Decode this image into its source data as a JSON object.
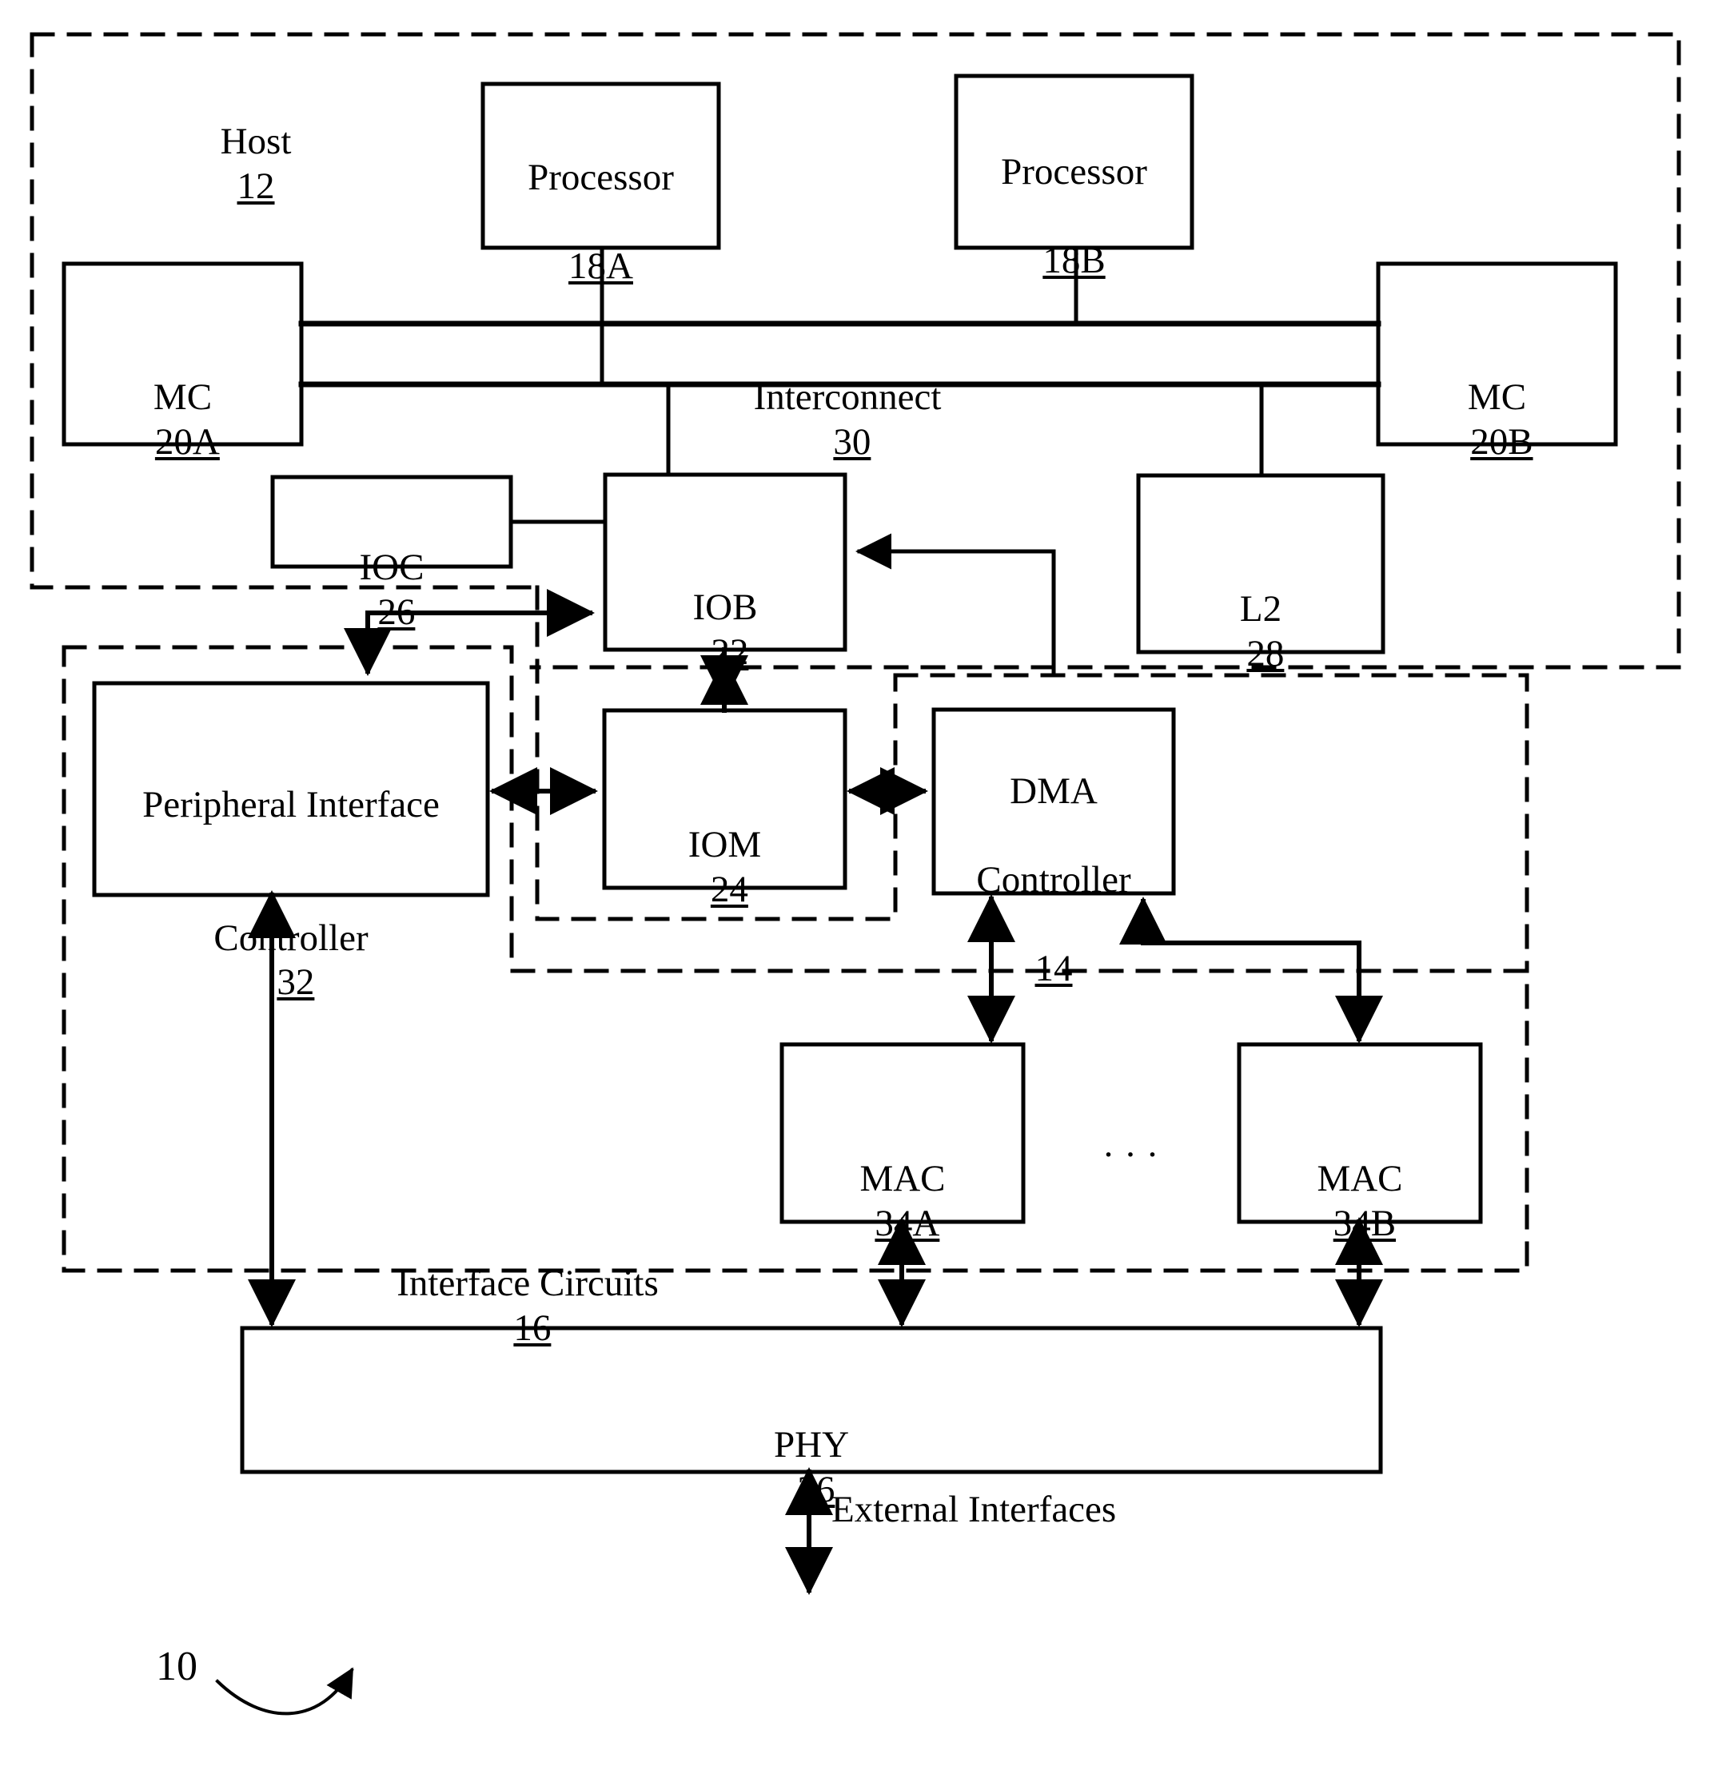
{
  "figure": {
    "reference_numeral": "10",
    "dots_between_macs": ". . ."
  },
  "dashed_regions": [
    {
      "name": "host",
      "label_text": "Host ",
      "label_num": "12"
    },
    {
      "name": "interface-circuits",
      "label_text": "Interface Circuits ",
      "label_num": "16"
    },
    {
      "name": "iom-region",
      "label_text": "",
      "label_num": ""
    },
    {
      "name": "dma-region",
      "label_text": "",
      "label_num": ""
    }
  ],
  "boxes": [
    {
      "id": "processor-18a",
      "line1": "Processor",
      "line2": "18A"
    },
    {
      "id": "processor-18b",
      "line1": "Processor",
      "line2": "18B"
    },
    {
      "id": "mc-20a",
      "line1": "MC ",
      "line2": "20A"
    },
    {
      "id": "mc-20b",
      "line1": "MC ",
      "line2": "20B"
    },
    {
      "id": "ioc-26",
      "line1": "IOC ",
      "line2": "26"
    },
    {
      "id": "iob-22",
      "line1": "IOB ",
      "line2": "22"
    },
    {
      "id": "l2-28",
      "line1": "L2 ",
      "line2": "28"
    },
    {
      "id": "peripheral-interface-controller-32",
      "line1": "Peripheral Interface",
      "line2": "Controller ",
      "line3": "32"
    },
    {
      "id": "iom-24",
      "line1": "IOM ",
      "line2": "24"
    },
    {
      "id": "dma-controller-14",
      "line1": "DMA",
      "line2": "Controller",
      "line3": "14"
    },
    {
      "id": "mac-34a",
      "line1": "MAC ",
      "line2": "34A"
    },
    {
      "id": "mac-34b",
      "line1": "MAC ",
      "line2": "34B"
    },
    {
      "id": "phy-36",
      "line1": "PHY ",
      "line2": "36"
    }
  ],
  "labels": {
    "host": "Host",
    "host_num": "12",
    "interconnect": "Interconnect",
    "interconnect_num": "30",
    "processor_a": "Processor",
    "processor_a_num": "18A",
    "processor_b": "Processor",
    "processor_b_num": "18B",
    "mc_a": "MC",
    "mc_a_num": "20A",
    "mc_b": "MC",
    "mc_b_num": "20B",
    "ioc": "IOC",
    "ioc_num": "26",
    "iob": "IOB",
    "iob_num": "22",
    "l2": "L2",
    "l2_num": "28",
    "pic_line1": "Peripheral Interface",
    "pic_line2": "Controller",
    "pic_num": "32",
    "iom": "IOM",
    "iom_num": "24",
    "dma_line1": "DMA",
    "dma_line2": "Controller",
    "dma_num": "14",
    "mac_a": "MAC",
    "mac_a_num": "34A",
    "mac_b": "MAC",
    "mac_b_num": "34B",
    "ellipsis": ". . .",
    "interface_circuits": "Interface Circuits",
    "interface_circuits_num": "16",
    "phy": "PHY",
    "phy_num": "36",
    "external_interfaces": "External Interfaces",
    "figure_num": "10"
  },
  "colors": {
    "stroke": "#000000",
    "background": "#ffffff"
  }
}
